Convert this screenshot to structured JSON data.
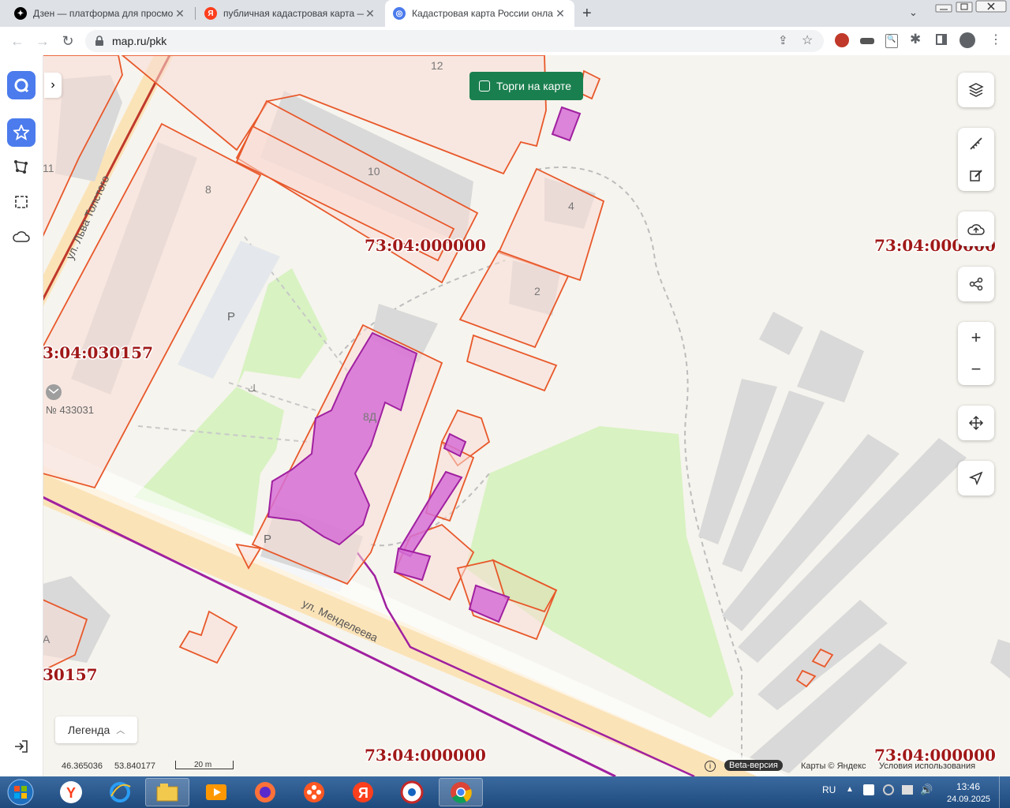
{
  "tabs": [
    {
      "title": "Дзен — платформа для просмо",
      "icon": "dzen-icon",
      "color": "#000000"
    },
    {
      "title": "публичная кадастровая карта —",
      "icon": "yandex-icon",
      "color": "#fc3f1d"
    },
    {
      "title": "Кадастровая карта России онла",
      "icon": "mapru-icon",
      "color": "#4b7bec"
    }
  ],
  "url": "map.ru/pkk",
  "torgi_label": "Торги на карте",
  "legend_label": "Легенда",
  "map_labels": {
    "cad1": "73:04:000000",
    "cad2": "73:04:000000",
    "cad3": "3:04:030157",
    "cad4": "30157",
    "cad5": "73:04:000000",
    "cad6": "73:04:000000",
    "house_12": "12",
    "house_11": "11",
    "house_10": "10",
    "house_8": "8",
    "house_4": "4",
    "house_2": "2",
    "house_8d": "8Д",
    "house_a": "А",
    "parking1": "P",
    "parking2": "P",
    "street1": "ул. Льва Толстого",
    "street2": "ул. Менделеева",
    "post": "№ 433031"
  },
  "coords": {
    "lat": "46.365036",
    "lon": "53.840177"
  },
  "scale": "20 m",
  "footer": {
    "beta": "Beta-версия",
    "copyright": "Карты © Яндекс",
    "terms": "Условия использования"
  },
  "system": {
    "lang": "RU",
    "time": "13:46",
    "date": "24.09.2025"
  }
}
